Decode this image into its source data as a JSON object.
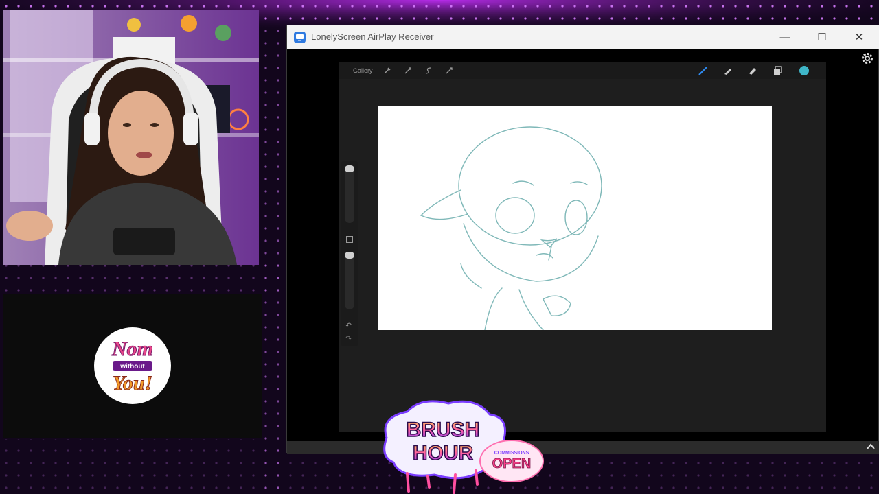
{
  "window": {
    "title": "LonelyScreen AirPlay Receiver",
    "minimize_glyph": "—",
    "maximize_glyph": "☐",
    "close_glyph": "✕"
  },
  "procreate": {
    "gallery_label": "Gallery",
    "brush_color": "#3fb6c8",
    "undo_glyph": "↶",
    "redo_glyph": "↷"
  },
  "icons": [
    "app-icon",
    "wrench-icon",
    "magic-wand-icon",
    "selection-icon",
    "transform-icon",
    "brush-icon",
    "smudge-icon",
    "eraser-icon",
    "layers-icon",
    "settings-icon",
    "scroll-up-icon"
  ],
  "overlay": {
    "nom_logo": "Nom without You!",
    "brush_hour": "BRUSH HOUR",
    "commissions": "COMMISSIONS",
    "open": "OPEN"
  },
  "colors": {
    "accent_purple": "#a020f0",
    "canvas_bg": "#ffffff",
    "sketch_line": "#7fb8b8"
  }
}
